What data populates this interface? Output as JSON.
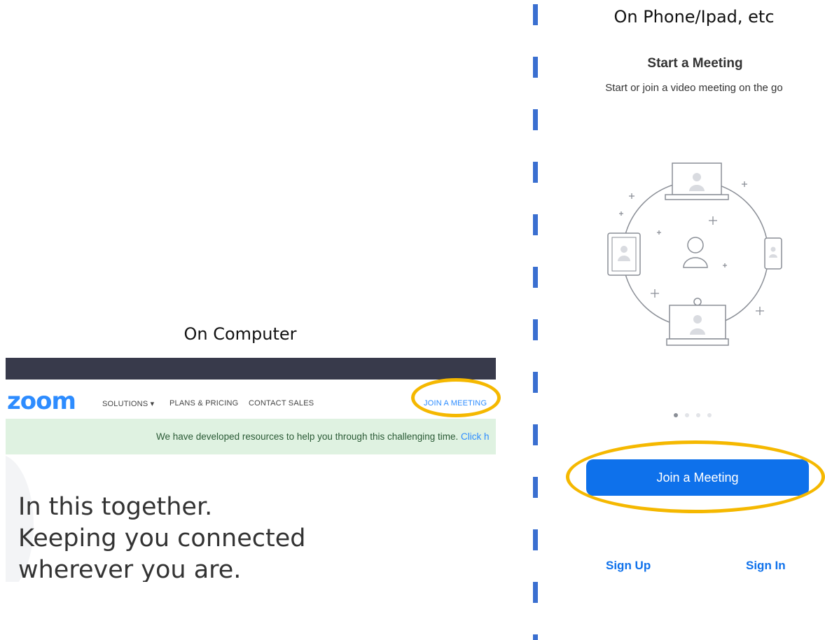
{
  "computer": {
    "caption": "On Computer",
    "website": {
      "logo": "zoom",
      "nav": {
        "solutions": "SOLUTIONS ▾",
        "plans_pricing": "PLANS & PRICING",
        "contact_sales": "CONTACT SALES",
        "join_meeting": "JOIN A MEETING"
      },
      "banner": {
        "text": "We have developed resources to help you through this challenging time.",
        "link": "Click h"
      },
      "hero": {
        "line1": "In this together.",
        "line2": "Keeping you connected",
        "line3": "wherever you are."
      }
    }
  },
  "phone": {
    "caption": "On Phone/Ipad, etc",
    "title": "Start a Meeting",
    "subtitle": "Start or join a video meeting on the go",
    "join_button": "Join a Meeting",
    "sign_up": "Sign Up",
    "sign_in": "Sign In",
    "pagination": {
      "count": 4,
      "active": 0
    }
  },
  "colors": {
    "zoom_blue": "#2d8cff",
    "app_button_blue": "#0e71eb",
    "highlight_yellow": "#f5b800",
    "divider_blue": "#3a6fd0",
    "topbar_dark": "#383a4b",
    "banner_green": "#dff2e1"
  }
}
